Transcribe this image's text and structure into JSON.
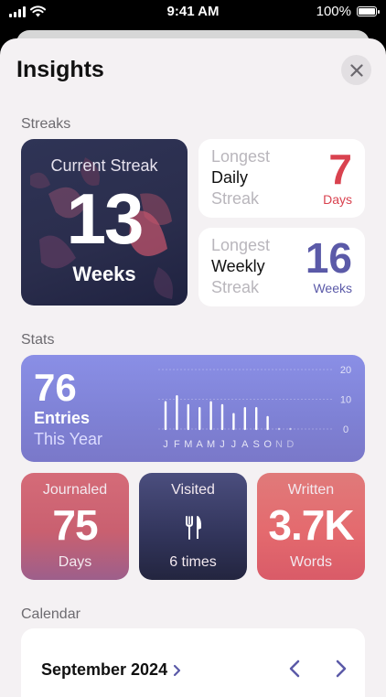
{
  "status_bar": {
    "time": "9:41 AM",
    "battery": "100%"
  },
  "title": "Insights",
  "sections": {
    "streaks": "Streaks",
    "stats": "Stats",
    "calendar": "Calendar"
  },
  "current_streak": {
    "label": "Current Streak",
    "value": "13",
    "unit": "Weeks"
  },
  "longest_daily": {
    "line1": "Longest",
    "line2": "Daily",
    "line3": "Streak",
    "value": "7",
    "unit": "Days",
    "color": "#d9424f"
  },
  "longest_weekly": {
    "line1": "Longest",
    "line2": "Weekly",
    "line3": "Streak",
    "value": "16",
    "unit": "Weeks",
    "color": "#5b5aa8"
  },
  "stats": {
    "entries": "76",
    "entries_label": "Entries",
    "period": "This Year",
    "months": [
      "J",
      "F",
      "M",
      "A",
      "M",
      "J",
      "J",
      "A",
      "S",
      "O",
      "N",
      "D"
    ],
    "monthly_entries": [
      9,
      11,
      8,
      7,
      9,
      8,
      5,
      7,
      7,
      4,
      0,
      0
    ],
    "y_ticks": [
      "20",
      "10",
      "0"
    ],
    "ylim": [
      0,
      20
    ]
  },
  "tiles": {
    "journaled": {
      "title": "Journaled",
      "value": "75",
      "unit": "Days"
    },
    "visited": {
      "title": "Visited",
      "unit": "6 times",
      "icon": "fork-knife-icon"
    },
    "written": {
      "title": "Written",
      "value": "3.7K",
      "unit": "Words"
    }
  },
  "calendar": {
    "month": "September 2024"
  }
}
